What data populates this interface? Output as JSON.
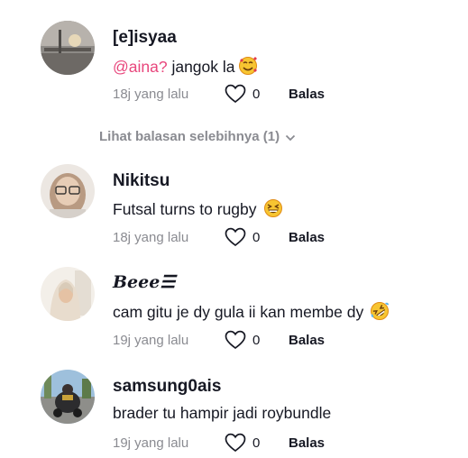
{
  "comments": [
    {
      "username": "[e]isyaa",
      "mention": "@aina?",
      "text": " jangok la",
      "emoji": "smiling-face-with-hearts",
      "time": "18j yang lalu",
      "likes": "0",
      "reply": "Balas"
    },
    {
      "username": "Nikitsu",
      "text": "Futsal turns to rugby",
      "emoji": "grinning-squinting-face",
      "time": "18j yang lalu",
      "likes": "0",
      "reply": "Balas"
    },
    {
      "username": "𝑩𝒆𝒆𝒆☰",
      "text": "cam gitu je dy gula ii kan membe dy",
      "emoji": "rolling-on-floor-laughing",
      "time": "19j yang lalu",
      "likes": "0",
      "reply": "Balas"
    },
    {
      "username": "samsung0ais",
      "text": "brader tu hampir jadi roybundle",
      "time": "19j yang lalu",
      "likes": "0",
      "reply": "Balas"
    }
  ],
  "more_replies": "Lihat balasan selebihnya (1)"
}
